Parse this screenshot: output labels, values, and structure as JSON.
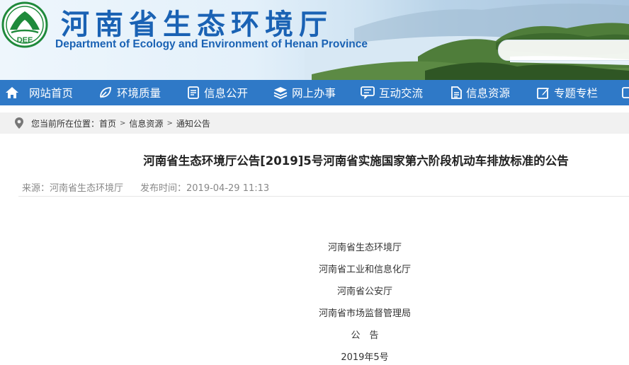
{
  "site": {
    "logo_text": "DEE",
    "title_cn": "河南省生态环境厅",
    "title_en": "Department of Ecology and Environment of Henan Province"
  },
  "colors": {
    "brand_blue": "#1a62b4",
    "nav_blue": "#2f79c7",
    "logo_green": "#1f8a3b"
  },
  "nav": {
    "items": [
      {
        "label": "网站首页",
        "icon": "home-icon"
      },
      {
        "label": "环境质量",
        "icon": "leaf-icon"
      },
      {
        "label": "信息公开",
        "icon": "document-icon"
      },
      {
        "label": "网上办事",
        "icon": "layers-icon"
      },
      {
        "label": "互动交流",
        "icon": "chat-icon"
      },
      {
        "label": "信息资源",
        "icon": "file-icon"
      },
      {
        "label": "专题专栏",
        "icon": "edit-icon"
      }
    ]
  },
  "breadcrumb": {
    "prefix": "您当前所在位置：",
    "items": [
      "首页",
      "信息资源",
      "通知公告"
    ]
  },
  "article": {
    "title": "河南省生态环境厅公告[2019]5号河南省实施国家第六阶段机动车排放标准的公告",
    "source": "来源：河南省生态环境厅",
    "time": "发布时间：2019-04-29 11:13",
    "lines": [
      "河南省生态环境厅",
      "河南省工业和信息化厅",
      "河南省公安厅",
      "河南省市场监督管理局",
      "公　告",
      "2019年5号"
    ]
  }
}
